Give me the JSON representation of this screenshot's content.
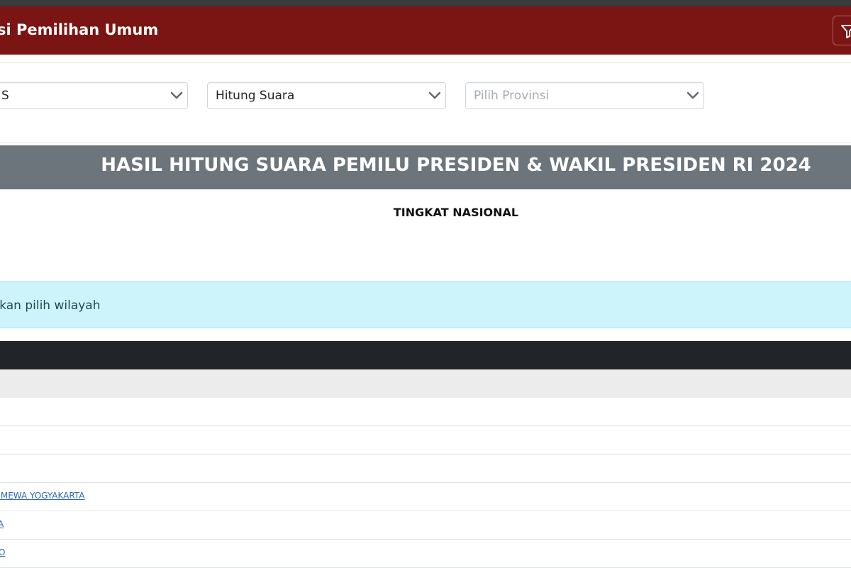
{
  "header": {
    "title": "si Pemilihan Umum",
    "bg_color": "#7a1513"
  },
  "filters": {
    "select_1": {
      "value": "S"
    },
    "select_2": {
      "value": "Hitung Suara"
    },
    "select_3": {
      "placeholder": "Pilih Provinsi"
    }
  },
  "banner": {
    "title": "HASIL HITUNG SUARA PEMILU PRESIDEN & WAKIL PRESIDEN RI 2024",
    "bg_color": "#6c747c"
  },
  "level": {
    "title": "TINGKAT NASIONAL"
  },
  "alert": {
    "text": "ahkan pilih wilayah"
  },
  "table": {
    "rows": [
      {
        "label": ""
      },
      {
        "label": ""
      },
      {
        "label": ""
      },
      {
        "label": "TIMEWA YOGYAKARTA"
      },
      {
        "label": "A"
      },
      {
        "label": "O"
      }
    ]
  },
  "icons": {
    "filter": "filter-icon",
    "dropdown": "chevron-down-icon"
  }
}
